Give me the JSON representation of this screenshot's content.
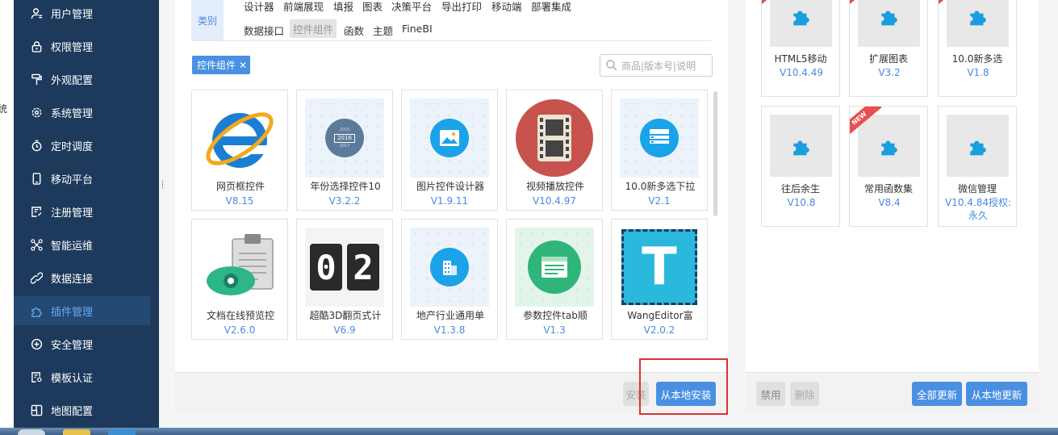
{
  "edge_text": "统",
  "sidebar": {
    "items": [
      {
        "label": "用户管理",
        "icon": "user-icon"
      },
      {
        "label": "权限管理",
        "icon": "lock-icon"
      },
      {
        "label": "外观配置",
        "icon": "paint-roller-icon"
      },
      {
        "label": "系统管理",
        "icon": "gear-icon"
      },
      {
        "label": "定时调度",
        "icon": "stopwatch-icon"
      },
      {
        "label": "移动平台",
        "icon": "mobile-icon"
      },
      {
        "label": "注册管理",
        "icon": "register-icon"
      },
      {
        "label": "智能运维",
        "icon": "network-icon"
      },
      {
        "label": "数据连接",
        "icon": "link-icon"
      },
      {
        "label": "插件管理",
        "icon": "puzzle-icon",
        "active": true
      },
      {
        "label": "安全管理",
        "icon": "shield-icon"
      },
      {
        "label": "模板认证",
        "icon": "certificate-icon"
      },
      {
        "label": "地图配置",
        "icon": "map-icon"
      }
    ]
  },
  "store": {
    "category_label": "类别",
    "categories_row1": [
      "设计器",
      "前端展现",
      "填报",
      "图表",
      "决策平台",
      "导出打印",
      "移动端",
      "部署集成"
    ],
    "categories_row2": [
      "数据接口",
      "控件组件",
      "函数",
      "主题",
      "FineBI"
    ],
    "selected_category": "控件组件",
    "active_tag": "控件组件",
    "tag_close": "✕",
    "search_placeholder": "商品|版本号|说明",
    "plugins": [
      {
        "name": "网页框控件",
        "version": "V8.15"
      },
      {
        "name": "年份选择控件10",
        "version": "V3.2.2",
        "thumb_years": [
          "2015",
          "2016",
          "2017"
        ]
      },
      {
        "name": "图片控件设计器",
        "version": "V1.9.11"
      },
      {
        "name": "视频播放控件",
        "version": "V10.4.97"
      },
      {
        "name": "10.0新多选下拉",
        "version": "V2.1"
      },
      {
        "name": "文档在线预览控",
        "version": "V2.6.0"
      },
      {
        "name": "超酷3D翻页式计",
        "version": "V6.9",
        "thumb_digits": [
          "0",
          "2"
        ]
      },
      {
        "name": "地产行业通用单",
        "version": "V1.3.8"
      },
      {
        "name": "参数控件tab顺",
        "version": "V1.3"
      },
      {
        "name": "WangEditor富",
        "version": "V2.0.2",
        "thumb_letter": "T"
      }
    ],
    "install_button": "安装",
    "install_local_button": "从本地安装"
  },
  "installed": {
    "plugins": [
      {
        "name": "HTML5移动",
        "version": "V10.4.49"
      },
      {
        "name": "扩展图表",
        "version": "V3.2"
      },
      {
        "name": "10.0新多选",
        "version": "V1.8"
      },
      {
        "name": "往后余生",
        "version": "V10.8"
      },
      {
        "name": "常用函数集",
        "version": "V8.4",
        "ribbon": "NEW"
      },
      {
        "name": "微信管理",
        "version": "V10.4.84授权:永久"
      }
    ],
    "disable_button": "禁用",
    "delete_button": "删除",
    "update_all_button": "全部更新",
    "update_local_button": "从本地更新"
  },
  "colors": {
    "sidebar_bg": "#1d3a5c",
    "accent": "#4a90e2",
    "highlight_box": "#e03030"
  }
}
